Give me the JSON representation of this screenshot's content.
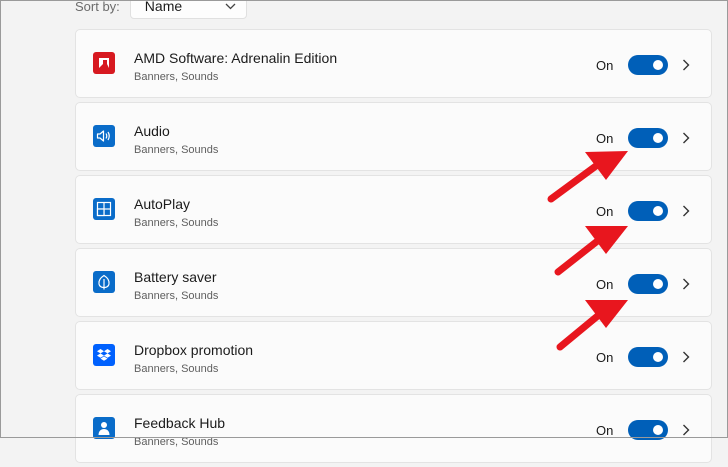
{
  "sort": {
    "label": "Sort by:",
    "value": "Name"
  },
  "apps": [
    {
      "name": "AMD Software: Adrenalin Edition",
      "subtitle": "Banners, Sounds",
      "state": "On",
      "enabled": true,
      "icon": "amd-icon",
      "icon_color": "#d71920"
    },
    {
      "name": "Audio",
      "subtitle": "Banners, Sounds",
      "state": "On",
      "enabled": true,
      "icon": "speaker-icon",
      "icon_color": "#0a6cc9"
    },
    {
      "name": "AutoPlay",
      "subtitle": "Banners, Sounds",
      "state": "On",
      "enabled": true,
      "icon": "autoplay-icon",
      "icon_color": "#0a6cc9"
    },
    {
      "name": "Battery saver",
      "subtitle": "Banners, Sounds",
      "state": "On",
      "enabled": true,
      "icon": "leaf-icon",
      "icon_color": "#0a6cc9"
    },
    {
      "name": "Dropbox promotion",
      "subtitle": "Banners, Sounds",
      "state": "On",
      "enabled": true,
      "icon": "dropbox-icon",
      "icon_color": "#0061fe"
    },
    {
      "name": "Feedback Hub",
      "subtitle": "Banners, Sounds",
      "state": "On",
      "enabled": true,
      "icon": "feedback-hub-icon",
      "icon_color": "#0a6cc9"
    }
  ],
  "colors": {
    "toggle_on": "#005fb8",
    "annotation_arrow": "#e8161e"
  }
}
